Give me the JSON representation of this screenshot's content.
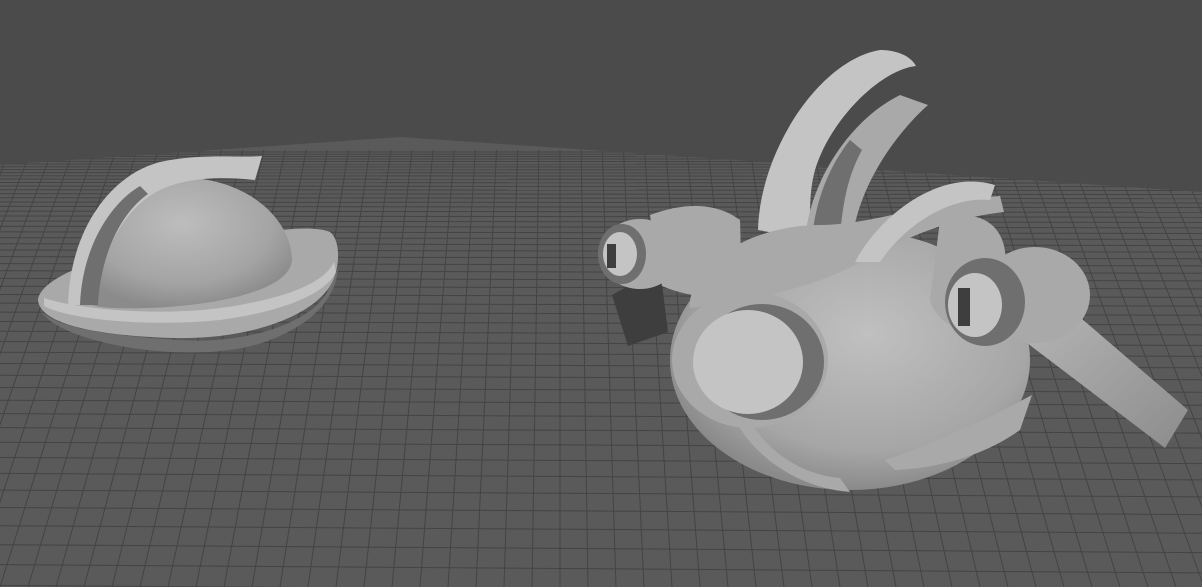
{
  "viewport": {
    "background_color": "#4b4b4b",
    "floor_color": "#5a5a5a",
    "grid_line_color": "#444444",
    "model_color": "#a9a9a9",
    "model_shadow_color": "#6f6f6f",
    "model_highlight_color": "#c4c4c4",
    "dark_accent_color": "#3e3e3e"
  },
  "objects": [
    {
      "name": "dome-helmet",
      "icon": "helmet-shape"
    },
    {
      "name": "robot-drone",
      "icon": "drone-shape"
    }
  ]
}
